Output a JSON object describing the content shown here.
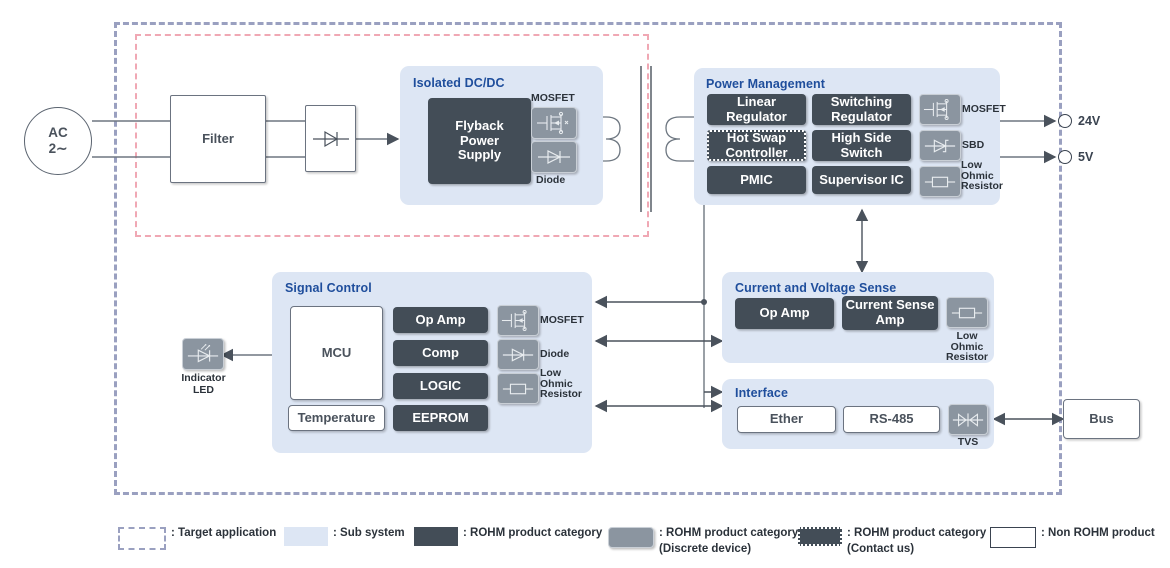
{
  "diagram": {
    "source": {
      "line1": "AC",
      "line2": "2∼"
    },
    "blocks": {
      "filter": "Filter",
      "bus": "Bus"
    },
    "outputs": [
      {
        "label": "24V"
      },
      {
        "label": "5V"
      }
    ],
    "indicator_led": {
      "line1": "Indicator",
      "line2": "LED"
    },
    "sections": [
      {
        "id": "isolated-dcdc",
        "title": "Isolated DC/DC",
        "items": [
          {
            "label": "Flyback\nPower\nSupply",
            "type": "rohm"
          }
        ],
        "symbols": [
          {
            "caption": "MOSFET",
            "glyph": "mosfet"
          },
          {
            "caption": "Diode",
            "glyph": "diode"
          }
        ]
      },
      {
        "id": "power-management",
        "title": "Power Management",
        "items": [
          {
            "label": "Linear\nRegulator",
            "type": "rohm"
          },
          {
            "label": "Switching\nRegulator",
            "type": "rohm"
          },
          {
            "label": "Hot Swap\nController",
            "type": "rohm-contact"
          },
          {
            "label": "High Side\nSwitch",
            "type": "rohm"
          },
          {
            "label": "PMIC",
            "type": "rohm"
          },
          {
            "label": "Supervisor IC",
            "type": "rohm"
          }
        ],
        "symbols": [
          {
            "caption": "MOSFET",
            "glyph": "mosfet"
          },
          {
            "caption": "SBD",
            "glyph": "sbd"
          },
          {
            "caption": "Low\nOhmic\nResistor",
            "glyph": "resistor"
          }
        ]
      },
      {
        "id": "signal-control",
        "title": "Signal Control",
        "items": [
          {
            "label": "MCU",
            "type": "non-rohm"
          },
          {
            "label": "Temperature",
            "type": "non-rohm"
          },
          {
            "label": "Op Amp",
            "type": "rohm"
          },
          {
            "label": "Comp",
            "type": "rohm"
          },
          {
            "label": "LOGIC",
            "type": "rohm"
          },
          {
            "label": "EEPROM",
            "type": "rohm"
          }
        ],
        "symbols": [
          {
            "caption": "MOSFET",
            "glyph": "mosfet"
          },
          {
            "caption": "Diode",
            "glyph": "diode"
          },
          {
            "caption": "Low\nOhmic\nResistor",
            "glyph": "resistor"
          }
        ]
      },
      {
        "id": "current-voltage-sense",
        "title": "Current and Voltage Sense",
        "items": [
          {
            "label": "Op Amp",
            "type": "rohm"
          },
          {
            "label": "Current Sense\nAmp",
            "type": "rohm"
          }
        ],
        "symbols": [
          {
            "caption": "Low\nOhmic\nResistor",
            "glyph": "resistor"
          }
        ]
      },
      {
        "id": "interface",
        "title": "Interface",
        "items": [
          {
            "label": "Ether",
            "type": "non-rohm"
          },
          {
            "label": "RS-485",
            "type": "non-rohm"
          }
        ],
        "symbols": [
          {
            "caption": "TVS",
            "glyph": "tvs"
          }
        ]
      }
    ],
    "legend": [
      {
        "swatch": "target",
        "text": ": Target application"
      },
      {
        "swatch": "sub",
        "text": ": Sub system"
      },
      {
        "swatch": "rohm",
        "text": ": ROHM product category"
      },
      {
        "swatch": "disc",
        "text": ": ROHM product category\n(Discrete device)"
      },
      {
        "swatch": "contact",
        "text": ": ROHM product category\n(Contact us)"
      },
      {
        "swatch": "non",
        "text": ": Non ROHM product"
      }
    ],
    "colors": {
      "target_boundary": "#9aa0c0",
      "inner_boundary": "#f0a8b4",
      "sub_system": "#dde6f4",
      "section_title": "#1f4e9c",
      "rohm_product": "#434d57",
      "discrete": "#8b95a0",
      "line": "#6e7781"
    }
  }
}
